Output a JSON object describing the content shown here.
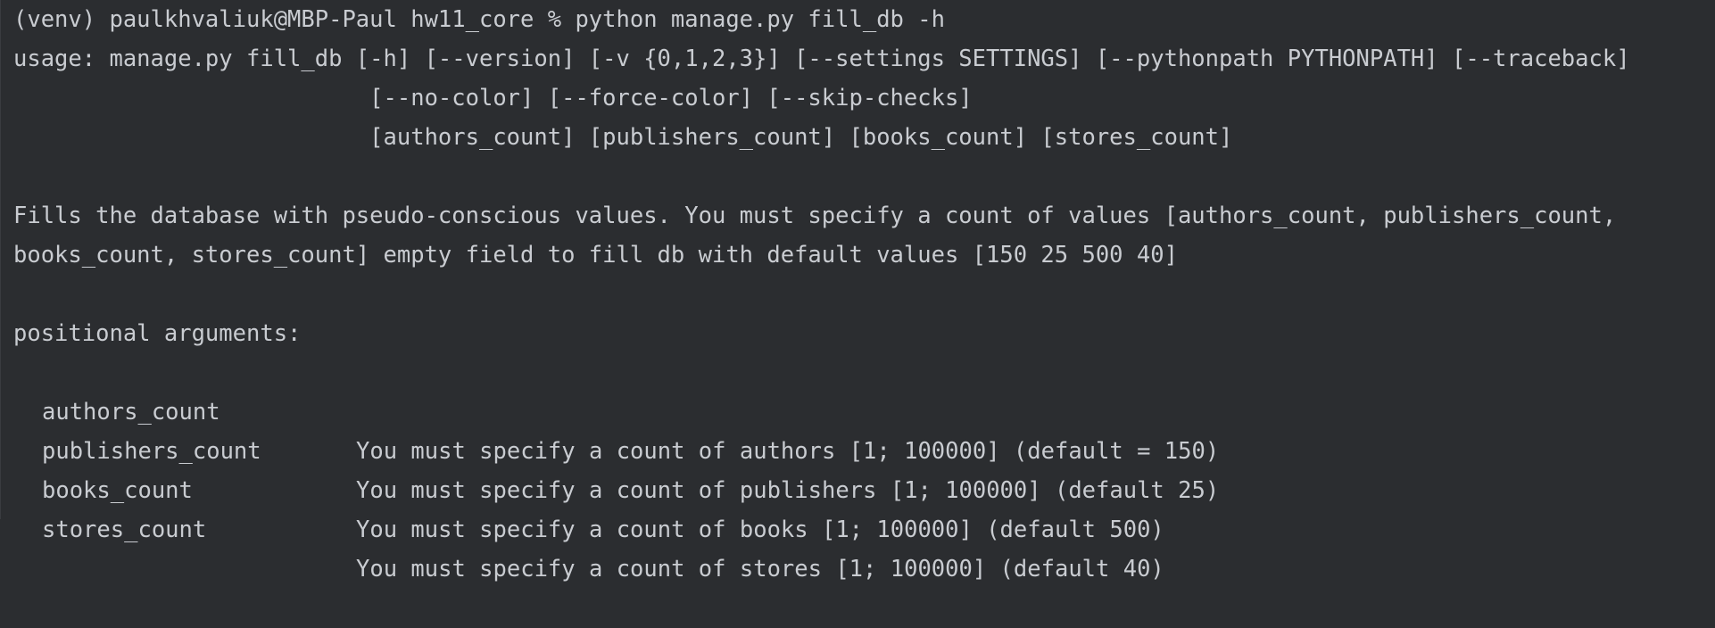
{
  "terminal": {
    "prompt_line": "(venv) paulkhvaliuk@MBP-Paul hw11_core % python manage.py fill_db -h",
    "usage_lines": [
      "usage: manage.py fill_db [-h] [--version] [-v {0,1,2,3}] [--settings SETTINGS] [--pythonpath PYTHONPATH] [--traceback]",
      "                          [--no-color] [--force-color] [--skip-checks]",
      "                          [authors_count] [publishers_count] [books_count] [stores_count]"
    ],
    "description_lines": [
      "Fills the database with pseudo-conscious values. You must specify a count of values [authors_count, publishers_count,",
      "books_count, stores_count] empty field to fill db with default values [150 25 500 40]"
    ],
    "positional_header": "positional arguments:",
    "arguments": [
      {
        "name": "authors_count",
        "help": "You must specify a count of authors [1; 100000] (default = 150)"
      },
      {
        "name": "publishers_count",
        "help": "You must specify a count of publishers [1; 100000] (default 25)"
      },
      {
        "name": "books_count",
        "help": "You must specify a count of books [1; 100000] (default 500)"
      },
      {
        "name": "stores_count",
        "help": "You must specify a count of stores [1; 100000] (default 40)"
      }
    ]
  }
}
